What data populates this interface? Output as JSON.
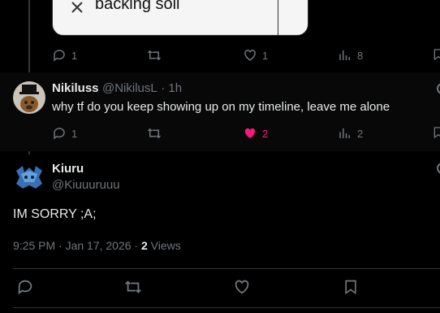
{
  "previous_tweet": {
    "card_text": "backing soil",
    "stats": {
      "replies": "1",
      "likes": "1",
      "views": "8"
    }
  },
  "reply": {
    "name": "Nikiluss",
    "handle": "@NikilusL",
    "time": "· 1h",
    "text": "why tf do you keep showing up on my timeline, leave me alone",
    "stats": {
      "replies": "1",
      "likes": "2",
      "views": "2"
    }
  },
  "main_tweet": {
    "name": "Kiuru",
    "handle": "@Kiuuuruuu",
    "text": "IM SORRY ;A;",
    "timestamp": "9:25 PM · Jan 17, 2026 ·",
    "views_count": "2",
    "views_label": "Views"
  },
  "colors": {
    "background": "#000000",
    "text": "#e7e9ea",
    "muted": "#71767b",
    "like_active": "#f91880",
    "divider": "#2f3336"
  },
  "icons": [
    "reply-icon",
    "retweet-icon",
    "like-icon",
    "views-icon",
    "bookmark-icon",
    "more-icon"
  ]
}
